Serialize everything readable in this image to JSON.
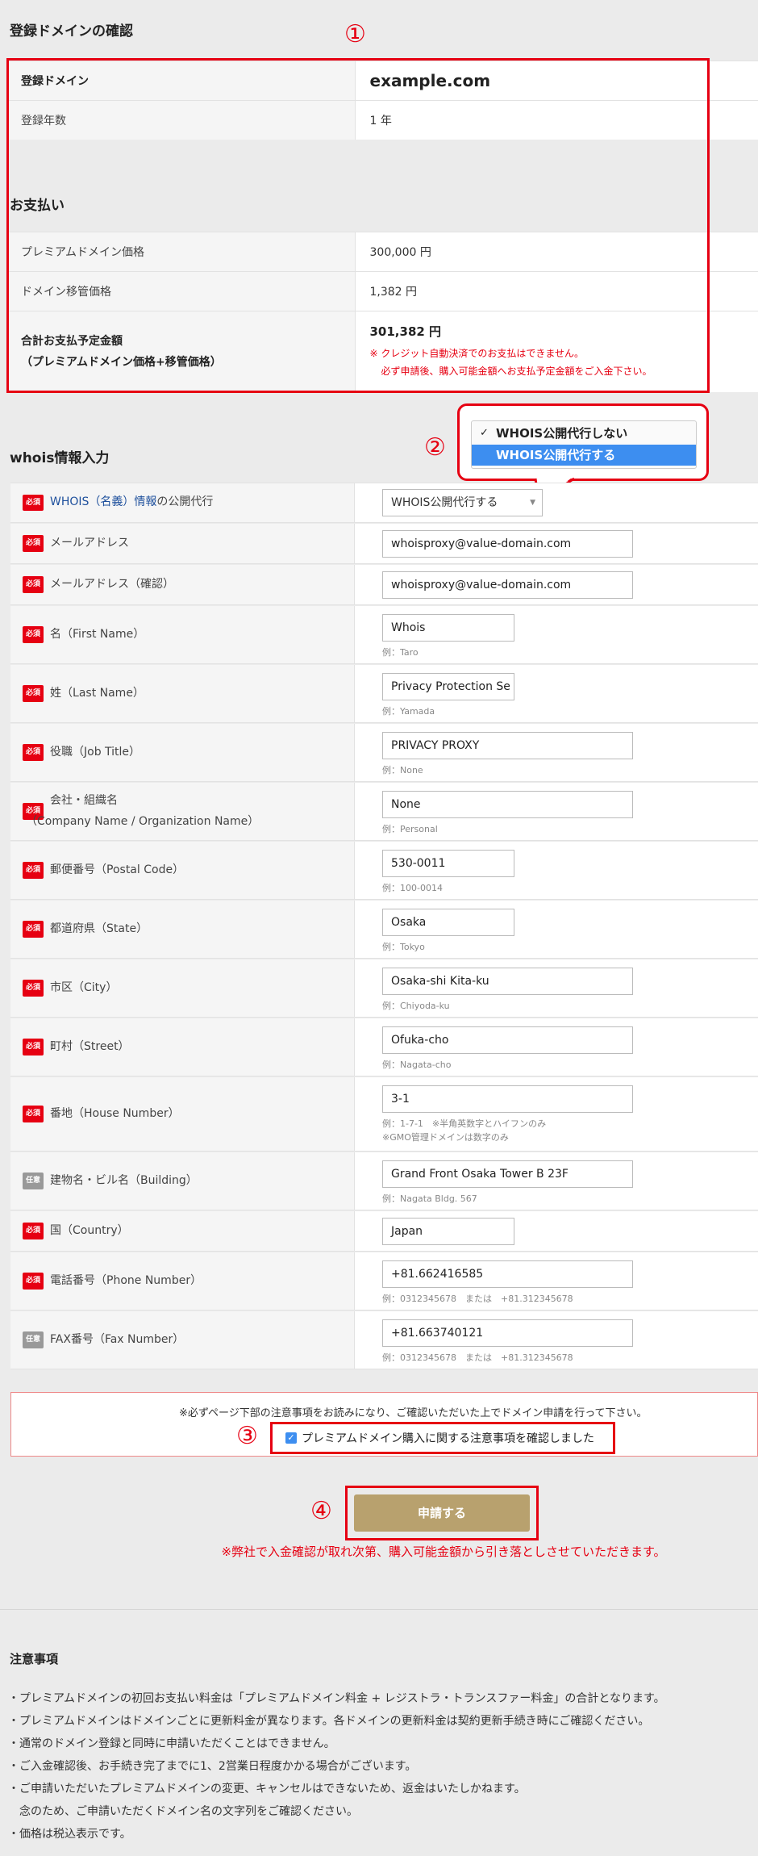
{
  "confirm": {
    "title": "登録ドメインの確認",
    "rows": [
      {
        "label": "登録ドメイン",
        "value": "example.com"
      },
      {
        "label": "登録年数",
        "value": "1 年"
      }
    ]
  },
  "payment": {
    "title": "お支払い",
    "rows": [
      {
        "label": "プレミアムドメイン価格",
        "value": "300,000 円"
      },
      {
        "label": "ドメイン移管価格",
        "value": "1,382 円"
      }
    ],
    "total": {
      "label1": "合計お支払予定金額",
      "label2": "（プレミアムドメイン価格+移管価格）",
      "value": "301,382 円",
      "note1": "※ クレジット自動決済でのお支払はできません。",
      "note2": "必ず申請後、購入可能金額へお支払予定金額をご入金下さい。"
    }
  },
  "annotations": {
    "n1": "①",
    "n2": "②",
    "n3": "③",
    "n4": "④"
  },
  "dropdown": {
    "options": [
      "WHOIS公開代行しない",
      "WHOIS公開代行する"
    ],
    "check": "✓"
  },
  "whois": {
    "title": "whois情報入力",
    "badge_req": "必須",
    "badge_opt": "任意",
    "proxy": {
      "link": "WHOIS（名義）情報",
      "suffix": "の公開代行",
      "value": "WHOIS公開代行する"
    },
    "fields": [
      {
        "label": "メールアドレス",
        "value": "whoisproxy@value-domain.com"
      },
      {
        "label": "メールアドレス（確認）",
        "value": "whoisproxy@value-domain.com"
      },
      {
        "label": "名（First Name）",
        "value": "Whois",
        "example": "例：Taro"
      },
      {
        "label": "姓（Last Name）",
        "value": "Privacy Protection Se",
        "example": "例：Yamada"
      },
      {
        "label": "役職（Job Title）",
        "value": "PRIVACY PROXY",
        "example": "例：None"
      },
      {
        "label": "会社・組織名",
        "label2": "（Company Name / Organization Name）",
        "value": "None",
        "example": "例：Personal"
      },
      {
        "label": "郵便番号（Postal Code）",
        "value": "530-0011",
        "example": "例：100-0014"
      },
      {
        "label": "都道府県（State）",
        "value": "Osaka",
        "example": "例：Tokyo"
      },
      {
        "label": "市区（City）",
        "value": "Osaka-shi Kita-ku",
        "example": "例：Chiyoda-ku"
      },
      {
        "label": "町村（Street）",
        "value": "Ofuka-cho",
        "example": "例：Nagata-cho"
      },
      {
        "label": "番地（House Number）",
        "value": "3-1",
        "example": "例：1-7-1　※半角英数字とハイフンのみ",
        "example2": "※GMO管理ドメインは数字のみ"
      },
      {
        "label": "建物名・ビル名（Building）",
        "value": "Grand Front Osaka Tower B 23F",
        "example": "例：Nagata Bldg. 567"
      },
      {
        "label": "国（Country）",
        "value": "Japan"
      },
      {
        "label": "電話番号（Phone Number）",
        "value": "+81.662416585",
        "example": "例：0312345678　または　+81.312345678"
      },
      {
        "label": "FAX番号（Fax Number）",
        "value": "+81.663740121",
        "example": "例：0312345678　または　+81.312345678"
      }
    ]
  },
  "agree": {
    "notice": "※必ずページ下部の注意事項をお読みになり、ご確認いただいた上でドメイン申請を行って下さい。",
    "checkbox_label": "プレミアムドメイン購入に関する注意事項を確認しました"
  },
  "submit": {
    "label": "申請する",
    "note": "※弊社で入金確認が取れ次第、購入可能金額から引き落としさせていただきます。"
  },
  "notes": {
    "title": "注意事項",
    "items": [
      "・プレミアムドメインの初回お支払い料金は「プレミアムドメイン料金 + レジストラ・トランスファー料金」の合計となります。",
      "・プレミアムドメインはドメインごとに更新料金が異なります。各ドメインの更新料金は契約更新手続き時にご確認ください。",
      "・通常のドメイン登録と同時に申請いただくことはできません。",
      "・ご入金確認後、お手続き完了までに1、2営業日程度かかる場合がございます。",
      "・ご申請いただいたプレミアムドメインの変更、キャンセルはできないため、返金はいたしかねます。",
      "　念のため、ご申請いただくドメイン名の文字列をご確認ください。",
      "・価格は税込表示です。"
    ]
  },
  "colors": {
    "accent_red": "#e60012",
    "button_gold": "#b8a16e",
    "link_blue": "#1d4f9c",
    "selected_blue": "#3d8ef0"
  }
}
